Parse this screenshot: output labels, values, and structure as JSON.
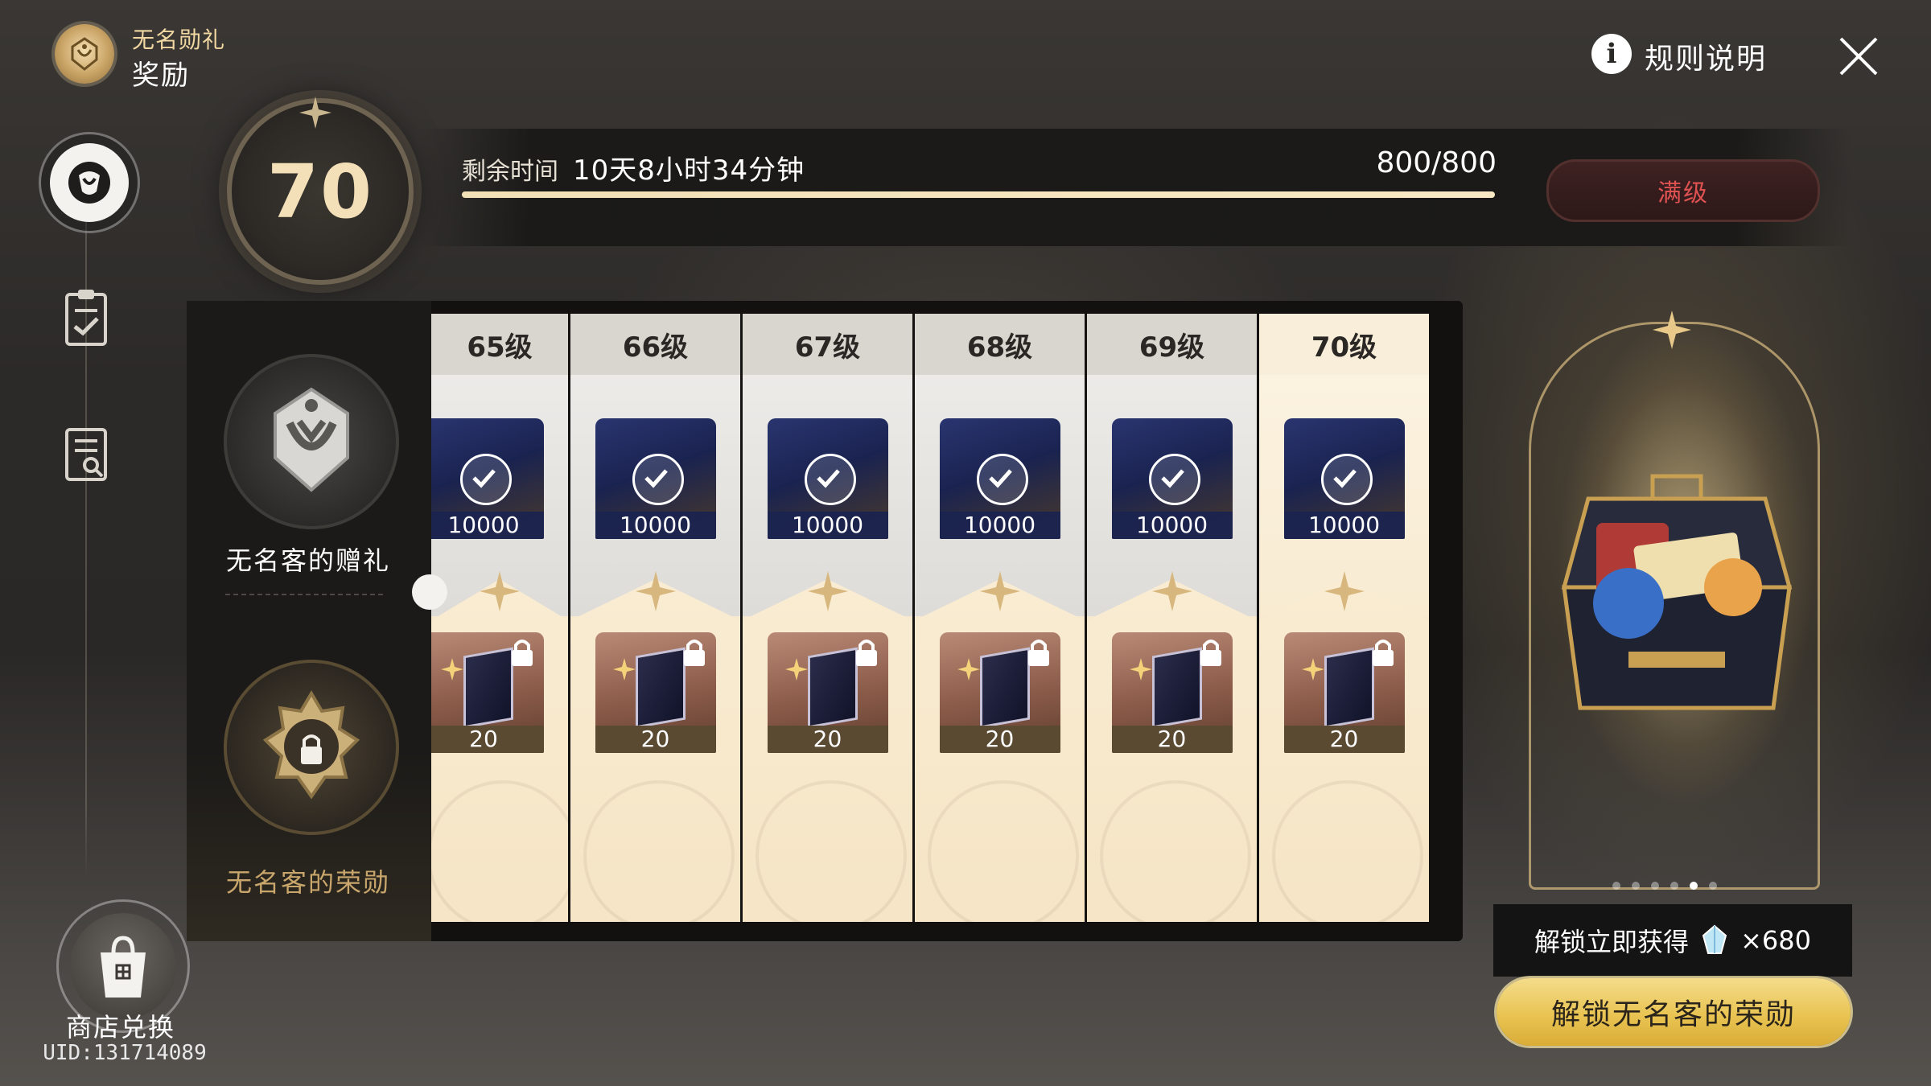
{
  "header": {
    "subtitle": "无名勋礼",
    "title": "奖励"
  },
  "level": {
    "current": "70"
  },
  "progress": {
    "remaining_label": "剩余时间",
    "remaining_value": "10天8小时34分钟",
    "xp_text": "800/800",
    "fill_fraction": 1.0,
    "max_label": "满级"
  },
  "top_right": {
    "rules_icon": "i",
    "rules_label": "规则说明"
  },
  "tiers": {
    "free_label": "无名客的赠礼",
    "paid_label": "无名客的荣勋"
  },
  "columns": [
    {
      "level_label": "65级",
      "free_icon": "ticket-icon",
      "free_qty": "10000",
      "paid_icon": "book-icon",
      "paid_qty": "20"
    },
    {
      "level_label": "66级",
      "free_icon": "ticket-icon",
      "free_qty": "10000",
      "paid_icon": "book-icon",
      "paid_qty": "20"
    },
    {
      "level_label": "67级",
      "free_icon": "ticket-icon",
      "free_qty": "10000",
      "paid_icon": "book-icon",
      "paid_qty": "20"
    },
    {
      "level_label": "68级",
      "free_icon": "ticket-icon",
      "free_qty": "10000",
      "paid_icon": "book-icon",
      "paid_qty": "20"
    },
    {
      "level_label": "69级",
      "free_icon": "ticket-icon",
      "free_qty": "10000",
      "paid_icon": "book-icon",
      "paid_qty": "20"
    },
    {
      "level_label": "70级",
      "free_icon": "ticket-icon",
      "free_qty": "10000",
      "paid_icon": "book-icon",
      "paid_qty": "20"
    }
  ],
  "unlock": {
    "info_label": "解锁立即获得",
    "info_amount": "×680",
    "button_label": "解锁无名客的荣勋",
    "carousel_active_index": 4,
    "carousel_count": 6
  },
  "bottom_left": {
    "shop_label": "商店兑换",
    "uid": "UID:131714089"
  }
}
